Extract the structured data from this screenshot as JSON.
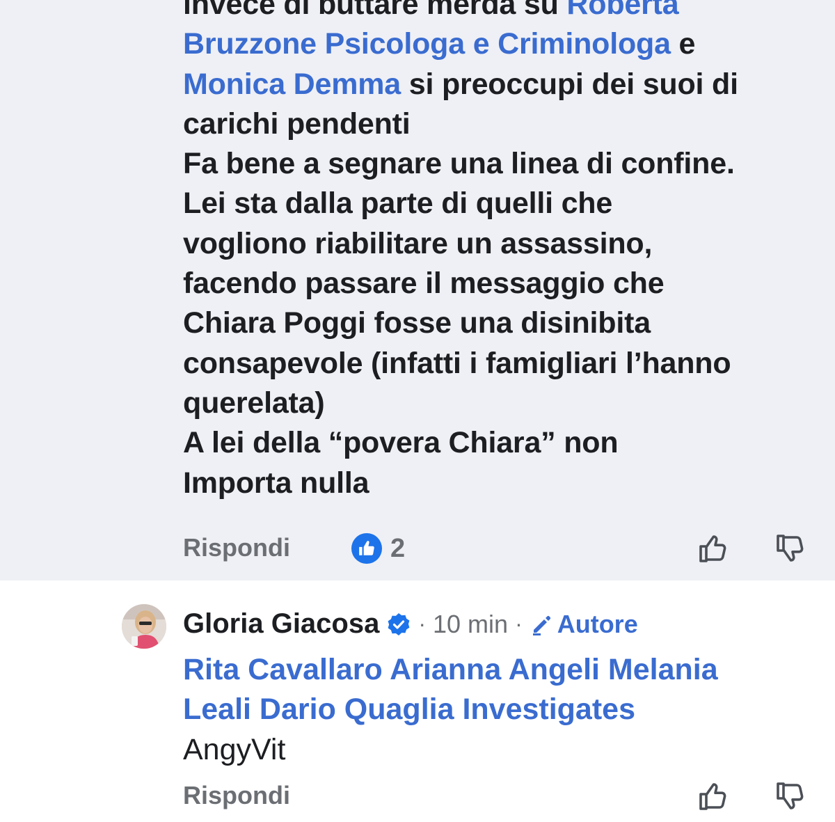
{
  "comment": {
    "lines": [
      [
        {
          "text": "invece di buttare merda su ",
          "mention": false
        },
        {
          "text": "Roberta",
          "mention": true
        }
      ],
      [
        {
          "text": "Bruzzone Psicologa e Criminologa",
          "mention": true
        },
        {
          "text": " e",
          "mention": false
        }
      ],
      [
        {
          "text": "Monica Demma",
          "mention": true
        },
        {
          "text": " si preoccupi dei suoi di",
          "mention": false
        }
      ],
      [
        {
          "text": "carichi pendenti",
          "mention": false
        }
      ],
      [
        {
          "text": "Fa bene a segnare una linea di confine.",
          "mention": false
        }
      ],
      [
        {
          "text": "Lei sta dalla parte di quelli che",
          "mention": false
        }
      ],
      [
        {
          "text": "vogliono riabilitare un assassino,",
          "mention": false
        }
      ],
      [
        {
          "text": "facendo passare il messaggio che",
          "mention": false
        }
      ],
      [
        {
          "text": "Chiara Poggi fosse una disinibita",
          "mention": false
        }
      ],
      [
        {
          "text": "consapevole (infatti i famigliari l’hanno",
          "mention": false
        }
      ],
      [
        {
          "text": "querelata)",
          "mention": false
        }
      ],
      [
        {
          "text": "A lei della “povera Chiara” non",
          "mention": false
        }
      ],
      [
        {
          "text": "Importa nulla",
          "mention": false
        }
      ]
    ],
    "reply_label": "Rispondi",
    "reaction_count": "2",
    "reaction_icon": "like-reaction-icon",
    "upvote_icon": "thumb-up-outline-icon",
    "downvote_icon": "thumb-down-outline-icon"
  },
  "reply": {
    "author": "Gloria Giacosa",
    "verified_icon": "verified-badge-icon",
    "separator": "·",
    "timestamp": "10 min",
    "author_badge": "Autore",
    "author_badge_icon": "pencil-icon",
    "lines": [
      [
        {
          "text": "Rita Cavallaro Arianna Angeli Melania",
          "mention": true
        }
      ],
      [
        {
          "text": "Leali Dario Quaglia Investigates",
          "mention": true
        }
      ],
      [
        {
          "text": "AngyVit",
          "mention": false
        }
      ]
    ],
    "reply_label": "Rispondi"
  },
  "colors": {
    "mention": "#3a6cd0",
    "top_background": "#eff0f5",
    "like_blue": "#1d73ea",
    "muted_text": "#6b6e73"
  }
}
